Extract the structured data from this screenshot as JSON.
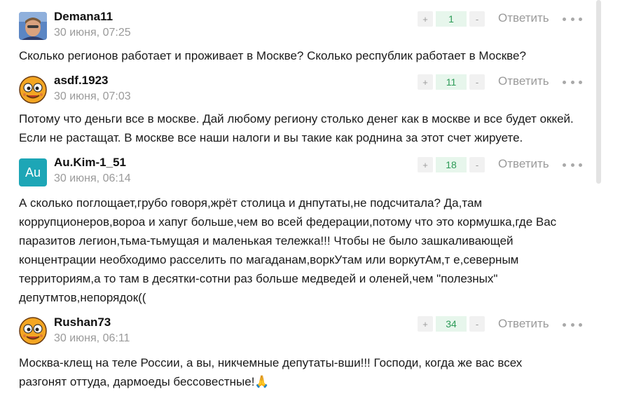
{
  "actions": {
    "reply_label": "Ответить",
    "upvote_symbol": "+",
    "downvote_symbol": "-"
  },
  "comments": [
    {
      "username": "Demana11",
      "timestamp": "30 июня, 07:25",
      "votes": "1",
      "avatar": "photo",
      "text": "Сколько регионов работает и проживает в Москве? Сколько республик работает в Москве?"
    },
    {
      "username": "asdf.1923",
      "timestamp": "30 июня, 07:03",
      "votes": "11",
      "avatar": "cartoon-face",
      "text": "Потому что деньги все в москве. Дай любому региону столько денег как в москве и все будет оккей. Если не растащат. В москве все наши налоги и вы такие как роднина за этот счет жируете."
    },
    {
      "username": "Au.Kim-1_51",
      "timestamp": "30 июня, 06:14",
      "votes": "18",
      "avatar": "letters",
      "avatar_letters": "Au",
      "text": "А сколько поглощает,грубо говоря,жрёт столица и днпутаты,не подсчитала? Да,там коррупционеров,вороа и хапуг больше,чем во всей федерации,потому что это кормушка,где Вас паразитов легион,тьма-тьмущая и маленькая тележка!!! Чтобы не было зашкаливающей концентрации необходимо расселить по магаданам,воркУтам или воркутАм,т е,северным территориям,а то там в десятки-сотни раз больше медведей и оленей,чем \"полезных\" депутмтов,непорядок(("
    },
    {
      "username": "Rushan73",
      "timestamp": "30 июня, 06:11",
      "votes": "34",
      "avatar": "cartoon-face",
      "text": "Москва-клещ на теле России, а вы, никчемные депутаты-вши!!! Господи, когда же вас всех разгонят оттуда, дармоеды бессовестные!🙏"
    }
  ],
  "colors": {
    "vote_bg": "#e7f6ec",
    "vote_text": "#2c9b57",
    "muted_text": "#9a9a9a",
    "avatar_teal": "#1da6b6"
  }
}
